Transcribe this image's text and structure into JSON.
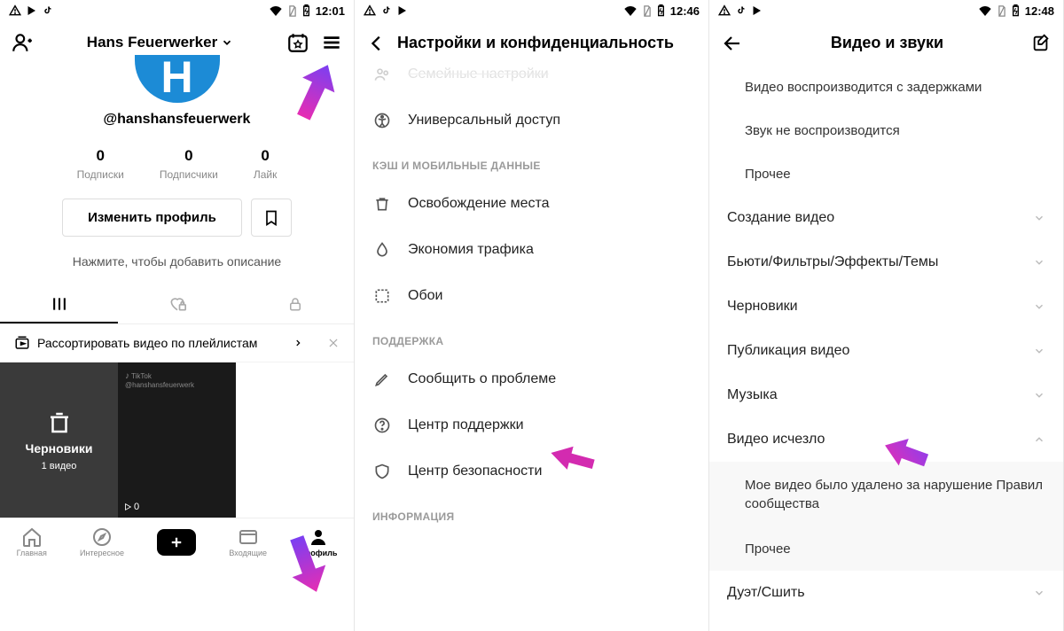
{
  "status": {
    "time1": "12:01",
    "time2": "12:46",
    "time3": "12:48"
  },
  "screen1": {
    "display_name": "Hans Feuerwerker",
    "handle": "@hanshansfeuerwerk",
    "avatar_letter": "H",
    "stats": [
      {
        "num": "0",
        "lbl": "Подписки"
      },
      {
        "num": "0",
        "lbl": "Подписчики"
      },
      {
        "num": "0",
        "lbl": "Лайк"
      }
    ],
    "edit": "Изменить профиль",
    "bio": "Нажмите, чтобы добавить описание",
    "playlist": "Рассортировать видео по плейлистам",
    "drafts_title": "Черновики",
    "drafts_sub": "1 видео",
    "tile_play": "0",
    "nav": [
      "Главная",
      "Интересное",
      "",
      "Входящие",
      "Профиль"
    ]
  },
  "screen2": {
    "title": "Настройки и конфиденциальность",
    "row_cut": "Семейные настройки",
    "rows_top": [
      {
        "icon": "access",
        "label": "Универсальный доступ"
      }
    ],
    "section_cache": "КЭШ И МОБИЛЬНЫЕ ДАННЫЕ",
    "rows_cache": [
      {
        "icon": "trash",
        "label": "Освобождение места"
      },
      {
        "icon": "drop",
        "label": "Экономия трафика"
      },
      {
        "icon": "wall",
        "label": "Обои"
      }
    ],
    "section_support": "ПОДДЕРЖКА",
    "rows_support": [
      {
        "icon": "pen",
        "label": "Сообщить о проблеме"
      },
      {
        "icon": "help",
        "label": "Центр поддержки"
      },
      {
        "icon": "shield",
        "label": "Центр безопасности"
      }
    ],
    "section_info": "ИНФОРМАЦИЯ"
  },
  "screen3": {
    "title": "Видео и звуки",
    "sub_items_top": [
      "Видео воспроизводится с задержками",
      "Звук не воспроизводится",
      "Прочее"
    ],
    "rows": [
      "Создание видео",
      "Бьюти/Фильтры/Эффекты/Темы",
      "Черновики",
      "Публикация видео",
      "Музыка"
    ],
    "expanded": "Видео исчезло",
    "expanded_items": [
      "Мое видео было удалено за нарушение Правил сообщества",
      "Прочее"
    ],
    "last": "Дуэт/Сшить"
  }
}
